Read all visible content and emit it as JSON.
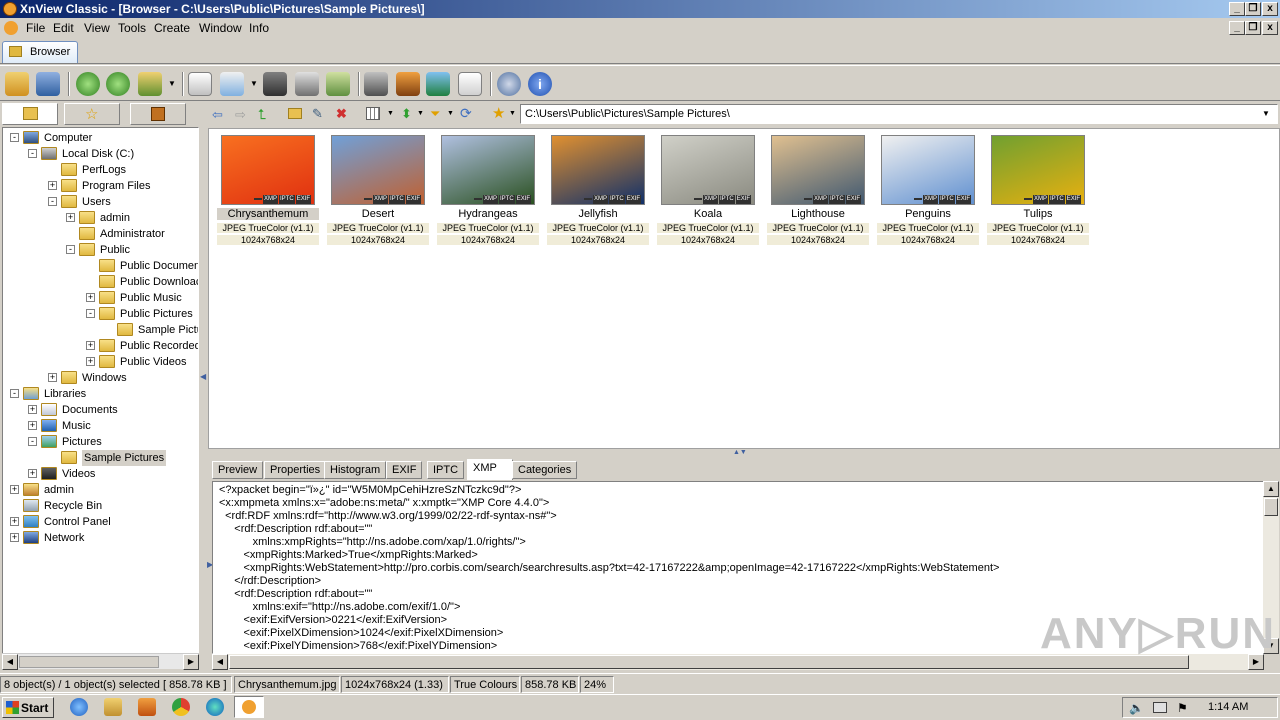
{
  "window": {
    "title": "XnView Classic - [Browser - C:\\Users\\Public\\Pictures\\Sample Pictures\\]",
    "min": "_",
    "max": "❐",
    "close": "x"
  },
  "menu": [
    "File",
    "Edit",
    "View",
    "Tools",
    "Create",
    "Window",
    "Info"
  ],
  "tab": {
    "browser": "Browser"
  },
  "path": "C:\\Users\\Public\\Pictures\\Sample Pictures\\",
  "tree": [
    {
      "label": "Computer",
      "icon": "computer-icon",
      "exp": "-"
    },
    {
      "label": "Local Disk (C:)",
      "icon": "disk-icon",
      "exp": "-"
    },
    {
      "label": "PerfLogs",
      "icon": "folder-icon",
      "exp": ""
    },
    {
      "label": "Program Files",
      "icon": "folder-icon",
      "exp": "+"
    },
    {
      "label": "Users",
      "icon": "folder-icon",
      "exp": "-"
    },
    {
      "label": "admin",
      "icon": "folder-icon",
      "exp": "+"
    },
    {
      "label": "Administrator",
      "icon": "folder-icon",
      "exp": ""
    },
    {
      "label": "Public",
      "icon": "folder-icon",
      "exp": "-"
    },
    {
      "label": "Public Documen",
      "icon": "folder-icon",
      "exp": ""
    },
    {
      "label": "Public Downloac",
      "icon": "folder-icon",
      "exp": ""
    },
    {
      "label": "Public Music",
      "icon": "folder-icon",
      "exp": "+"
    },
    {
      "label": "Public Pictures",
      "icon": "folder-icon",
      "exp": "-"
    },
    {
      "label": "Sample Pictu",
      "icon": "folder-icon",
      "exp": ""
    },
    {
      "label": "Public Recorded",
      "icon": "folder-icon",
      "exp": "+"
    },
    {
      "label": "Public Videos",
      "icon": "folder-icon",
      "exp": "+"
    },
    {
      "label": "Windows",
      "icon": "folder-icon",
      "exp": "+"
    },
    {
      "label": "Libraries",
      "icon": "library-icon",
      "exp": "-"
    },
    {
      "label": "Documents",
      "icon": "documents-icon",
      "exp": "+"
    },
    {
      "label": "Music",
      "icon": "music-icon",
      "exp": "+"
    },
    {
      "label": "Pictures",
      "icon": "pictures-icon",
      "exp": "-"
    },
    {
      "label": "Sample Pictures",
      "icon": "folder-icon",
      "exp": ""
    },
    {
      "label": "Videos",
      "icon": "videos-icon",
      "exp": "+"
    },
    {
      "label": "admin",
      "icon": "user-icon",
      "exp": "+"
    },
    {
      "label": "Recycle Bin",
      "icon": "recycle-bin-icon",
      "exp": ""
    },
    {
      "label": "Control Panel",
      "icon": "control-panel-icon",
      "exp": "+"
    },
    {
      "label": "Network",
      "icon": "network-icon",
      "exp": "+"
    }
  ],
  "thumbnails": [
    {
      "name": "Chrysanthemum",
      "format": "JPEG TrueColor (v1.1)",
      "dims": "1024x768x24",
      "color": "#e03010",
      "color2": "#f87020"
    },
    {
      "name": "Desert",
      "format": "JPEG TrueColor (v1.1)",
      "dims": "1024x768x24",
      "color": "#c06030",
      "color2": "#70a0d8"
    },
    {
      "name": "Hydrangeas",
      "format": "JPEG TrueColor (v1.1)",
      "dims": "1024x768x24",
      "color": "#2a5020",
      "color2": "#b0c0e0"
    },
    {
      "name": "Jellyfish",
      "format": "JPEG TrueColor (v1.1)",
      "dims": "1024x768x24",
      "color": "#10306a",
      "color2": "#e09030"
    },
    {
      "name": "Koala",
      "format": "JPEG TrueColor (v1.1)",
      "dims": "1024x768x24",
      "color": "#8a8a80",
      "color2": "#d0d0c8"
    },
    {
      "name": "Lighthouse",
      "format": "JPEG TrueColor (v1.1)",
      "dims": "1024x768x24",
      "color": "#405870",
      "color2": "#e0c090"
    },
    {
      "name": "Penguins",
      "format": "JPEG TrueColor (v1.1)",
      "dims": "1024x768x24",
      "color": "#6090d0",
      "color2": "#f0f0f0"
    },
    {
      "name": "Tulips",
      "format": "JPEG TrueColor (v1.1)",
      "dims": "1024x768x24",
      "color": "#e8b010",
      "color2": "#70a030"
    }
  ],
  "badges": [
    "XMP",
    "IPTC",
    "EXIF"
  ],
  "bottom_tabs": [
    "Preview",
    "Properties",
    "Histogram",
    "EXIF",
    "IPTC",
    "XMP",
    "Categories"
  ],
  "xmp_lines": [
    "<?xpacket begin=\"ï»¿\" id=\"W5M0MpCehiHzreSzNTczkc9d\"?>",
    "<x:xmpmeta xmlns:x=\"adobe:ns:meta/\" x:xmptk=\"XMP Core 4.4.0\">",
    "  <rdf:RDF xmlns:rdf=\"http://www.w3.org/1999/02/22-rdf-syntax-ns#\">",
    "     <rdf:Description rdf:about=\"\"",
    "           xmlns:xmpRights=\"http://ns.adobe.com/xap/1.0/rights/\">",
    "        <xmpRights:Marked>True</xmpRights:Marked>",
    "        <xmpRights:WebStatement>http://pro.corbis.com/search/searchresults.asp?txt=42-17167222&amp;openImage=42-17167222</xmpRights:WebStatement>",
    "     </rdf:Description>",
    "     <rdf:Description rdf:about=\"\"",
    "           xmlns:exif=\"http://ns.adobe.com/exif/1.0/\">",
    "        <exif:ExifVersion>0221</exif:ExifVersion>",
    "        <exif:PixelXDimension>1024</exif:PixelXDimension>",
    "        <exif:PixelYDimension>768</exif:PixelYDimension>"
  ],
  "status": {
    "objects": "8 object(s) / 1 object(s) selected  [ 858.78 KB ]",
    "file": "Chrysanthemum.jpg",
    "dims": "1024x768x24 (1.33)",
    "colours": "True Colours",
    "size": "858.78 KB",
    "zoom": "24%"
  },
  "taskbar": {
    "start": "Start",
    "clock": "1:14 AM"
  },
  "watermark": "ANY▷RUN",
  "colors": {
    "titlebar_start": "#0a246a",
    "titlebar_end": "#a6caf0",
    "selection": "#d4d0c8"
  }
}
